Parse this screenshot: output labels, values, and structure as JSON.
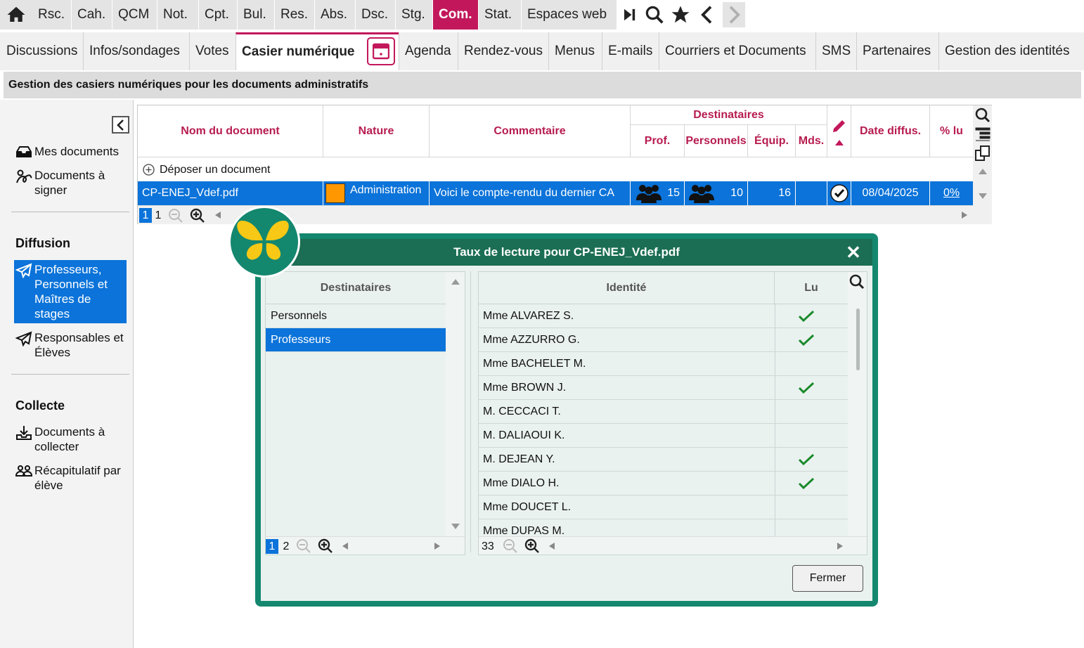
{
  "topnav": {
    "items": [
      "Rsc.",
      "Cah.",
      "QCM",
      "Not.",
      "Cpt.",
      "Bul.",
      "Res.",
      "Abs.",
      "Dsc.",
      "Stg.",
      "Com.",
      "Stat.",
      "Espaces web"
    ],
    "active": "Com.",
    "icons": [
      "home-icon",
      "skip-end-icon",
      "search-icon",
      "star-icon",
      "back-icon",
      "forward-icon"
    ]
  },
  "subnav": {
    "items": [
      "Discussions",
      "Infos/sondages",
      "Votes",
      "Casier numérique",
      "Agenda",
      "Rendez-vous",
      "Menus",
      "E-mails",
      "Courriers et Documents",
      "SMS",
      "Partenaires",
      "Gestion des identités"
    ],
    "active": "Casier numérique"
  },
  "page_title": "Gestion des casiers numériques pour les documents administratifs",
  "sidebar": {
    "items": [
      {
        "label": "Mes documents",
        "icon": "inbox-icon"
      },
      {
        "label": "Documents à signer",
        "icon": "signature-icon"
      }
    ],
    "diffusion": {
      "title": "Diffusion",
      "items": [
        {
          "label": "Professeurs, Personnels et Maîtres de stages",
          "icon": "send-icon",
          "active": true
        },
        {
          "label": "Responsables et Élèves",
          "icon": "send-icon",
          "active": false
        }
      ]
    },
    "collecte": {
      "title": "Collecte",
      "items": [
        {
          "label": "Documents à collecter",
          "icon": "download-tray-icon"
        },
        {
          "label": "Récapitulatif par élève",
          "icon": "users-icon"
        }
      ]
    }
  },
  "grid": {
    "headers": {
      "nom": "Nom du document",
      "nature": "Nature",
      "commentaire": "Commentaire",
      "destinataires": "Destinataires",
      "prof": "Prof.",
      "personnels": "Personnels",
      "equip": "Équip.",
      "mds": "Mds.",
      "date": "Date diffus.",
      "lu": "% lu"
    },
    "add_label": "Déposer un document",
    "rows": [
      {
        "nom": "CP-ENEJ_Vdef.pdf",
        "nature": "Administration",
        "nature_color": "#ff9800",
        "commentaire": "Voici le compte-rendu du dernier CA",
        "prof": "15",
        "personnels": "10",
        "equip": "16",
        "mds": "",
        "date": "08/04/2025",
        "lu": "0%"
      }
    ],
    "pages": [
      "1",
      "1"
    ]
  },
  "modal": {
    "title": "Taux de lecture pour CP-ENEJ_Vdef.pdf",
    "left_header": "Destinataires",
    "left_items": [
      "Personnels",
      "Professeurs"
    ],
    "left_selected": "Professeurs",
    "left_pages": [
      "1",
      "2"
    ],
    "right_headers": {
      "identite": "Identité",
      "lu": "Lu"
    },
    "rows": [
      {
        "name": "Mme ALVAREZ S.",
        "lu": true
      },
      {
        "name": "Mme AZZURRO G.",
        "lu": true
      },
      {
        "name": "Mme BACHELET M.",
        "lu": false
      },
      {
        "name": "Mme BROWN J.",
        "lu": true
      },
      {
        "name": "M. CECCACI T.",
        "lu": false
      },
      {
        "name": "M. DALIAOUI K.",
        "lu": false
      },
      {
        "name": "M. DEJEAN Y.",
        "lu": true
      },
      {
        "name": "Mme DIALO H.",
        "lu": true
      },
      {
        "name": "Mme DOUCET L.",
        "lu": false
      },
      {
        "name": "Mme DUPAS M.",
        "lu": false
      }
    ],
    "right_count": "33",
    "close_button": "Fermer"
  },
  "colors": {
    "accent": "#c2185b",
    "selection": "#0b73d9",
    "modal": "#14876f",
    "modal_header": "#1b6e53",
    "check": "#1a8a2a"
  }
}
